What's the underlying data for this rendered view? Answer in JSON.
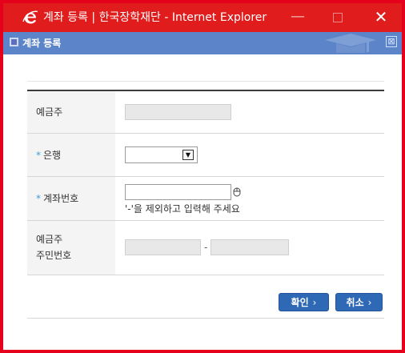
{
  "window": {
    "title": "계좌 등록 | 한국장학재단 - Internet Explorer",
    "minimize_symbol": "—",
    "close_symbol": "✕"
  },
  "dialog": {
    "title": "계좌 등록",
    "close_symbol": "⊠"
  },
  "form": {
    "depositor_label": "예금주",
    "bank_label": "은행",
    "account_label": "계좌번호",
    "required_mark": "*",
    "account_hint": "'-'을 제외하고 입력해 주세요",
    "rrn_label_line1": "예금주",
    "rrn_label_line2": "주민번호",
    "rrn_separator": "-"
  },
  "buttons": {
    "ok_label": "확인",
    "cancel_label": "취소",
    "chevron": "›"
  },
  "colors": {
    "window_border": "#e5001b",
    "titlebar": "#e01c1c",
    "dialog_header": "#5c84c8",
    "button": "#2f69b6",
    "required": "#3aa0d8"
  }
}
